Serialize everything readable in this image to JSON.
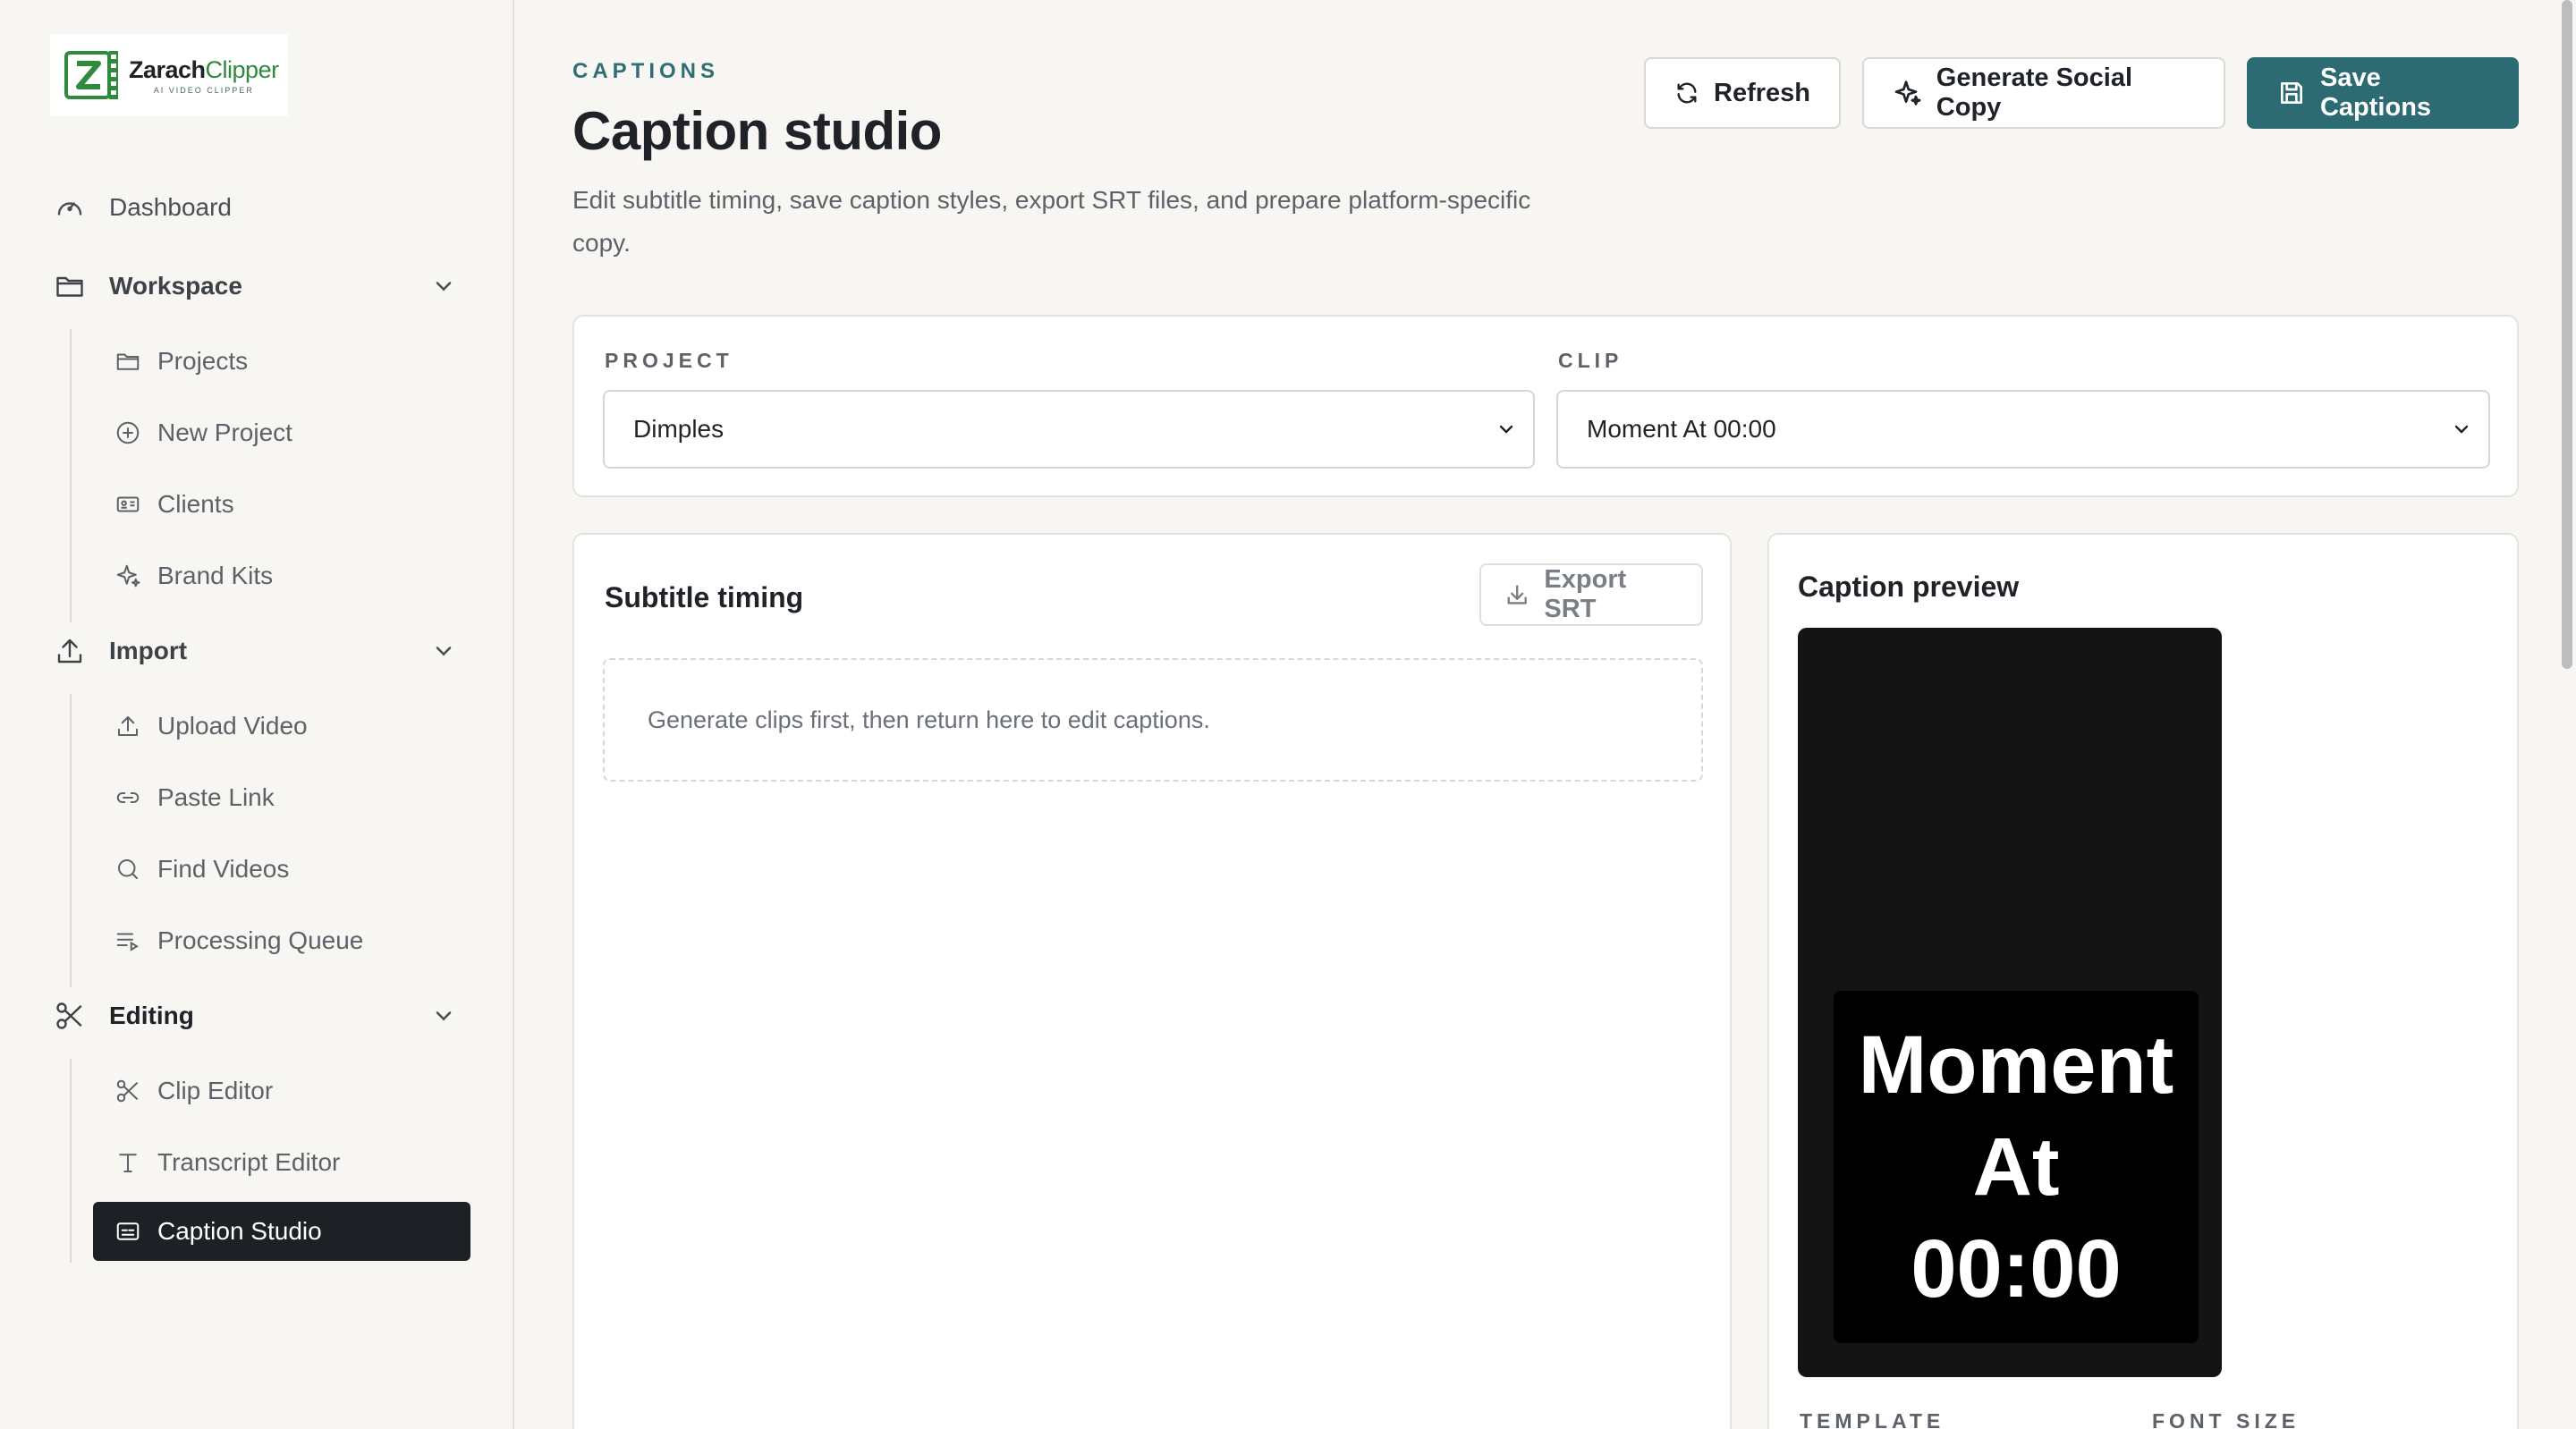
{
  "brand": {
    "name_bold": "Zarach",
    "name_light": "Clipper",
    "tagline": "AI VIDEO CLIPPER",
    "accent_color": "#2c6b71",
    "logo_color": "#2f8a3c"
  },
  "sidebar": {
    "dashboard": {
      "label": "Dashboard",
      "icon": "gauge-icon"
    },
    "groups": [
      {
        "label": "Workspace",
        "icon": "folder-icon",
        "items": [
          {
            "label": "Projects",
            "icon": "folder-icon"
          },
          {
            "label": "New Project",
            "icon": "plus-circle-icon"
          },
          {
            "label": "Clients",
            "icon": "id-card-icon"
          },
          {
            "label": "Brand Kits",
            "icon": "sparkles-icon"
          }
        ]
      },
      {
        "label": "Import",
        "icon": "upload-icon",
        "items": [
          {
            "label": "Upload Video",
            "icon": "upload-icon"
          },
          {
            "label": "Paste Link",
            "icon": "link-icon"
          },
          {
            "label": "Find Videos",
            "icon": "search-icon"
          },
          {
            "label": "Processing Queue",
            "icon": "list-play-icon"
          }
        ]
      },
      {
        "label": "Editing",
        "icon": "scissors-icon",
        "items": [
          {
            "label": "Clip Editor",
            "icon": "scissors-icon"
          },
          {
            "label": "Transcript Editor",
            "icon": "type-icon"
          },
          {
            "label": "Caption Studio",
            "icon": "captions-icon",
            "active": true
          }
        ]
      }
    ]
  },
  "header": {
    "eyebrow": "CAPTIONS",
    "title": "Caption studio",
    "description": "Edit subtitle timing, save caption styles, export SRT files, and prepare platform-specific copy.",
    "buttons": {
      "refresh": "Refresh",
      "social": "Generate Social Copy",
      "save": "Save Captions"
    }
  },
  "selectors": {
    "project_label": "PROJECT",
    "project_value": "Dimples",
    "clip_label": "CLIP",
    "clip_value": "Moment At 00:00"
  },
  "timing": {
    "title": "Subtitle timing",
    "export_label": "Export SRT",
    "empty_message": "Generate clips first, then return here to edit captions."
  },
  "preview": {
    "title": "Caption preview",
    "caption_lines": [
      "Moment",
      "At",
      "00:00"
    ],
    "template_label": "TEMPLATE",
    "font_size_label": "FONT SIZE"
  }
}
